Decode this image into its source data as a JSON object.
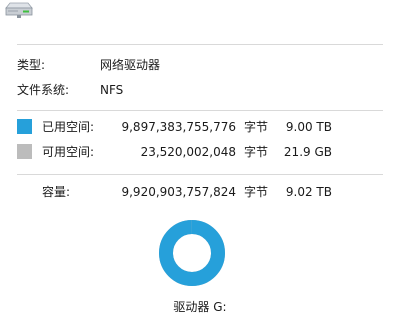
{
  "info": {
    "type_label": "类型:",
    "type_value": "网络驱动器",
    "fs_label": "文件系统:",
    "fs_value": "NFS"
  },
  "usage": {
    "used": {
      "label": "已用空间:",
      "bytes": "9,897,383,755,776",
      "unit": "字节",
      "size": "9.00 TB",
      "color": "#26a0da"
    },
    "free": {
      "label": "可用空间:",
      "bytes": "23,520,002,048",
      "unit": "字节",
      "size": "21.9 GB",
      "color": "#bcbcbc"
    },
    "capacity": {
      "label": "容量:",
      "bytes": "9,920,903,757,824",
      "unit": "字节",
      "size": "9.02 TB"
    },
    "used_fraction": 0.9976
  },
  "drive_label": "驱动器 G:",
  "icons": {
    "drive": "network-drive-icon"
  }
}
